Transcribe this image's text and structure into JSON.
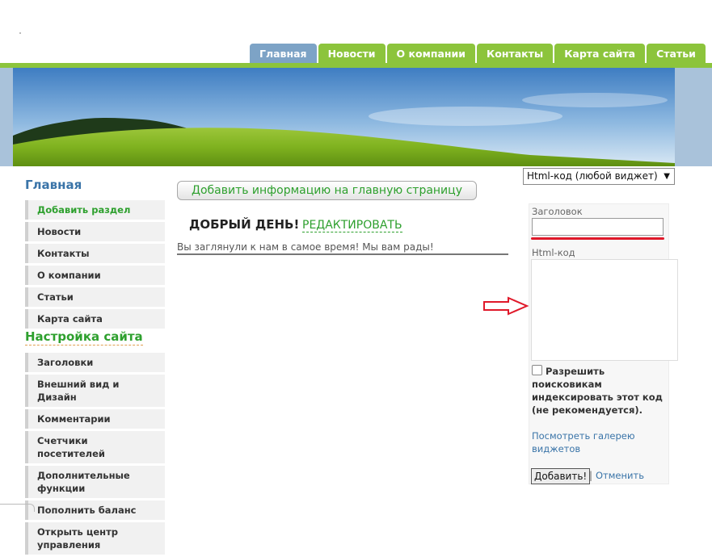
{
  "nav": {
    "tabs": [
      {
        "label": "Главная",
        "active": true
      },
      {
        "label": "Новости",
        "active": false
      },
      {
        "label": "О компании",
        "active": false
      },
      {
        "label": "Контакты",
        "active": false
      },
      {
        "label": "Карта сайта",
        "active": false
      },
      {
        "label": "Статьи",
        "active": false
      }
    ]
  },
  "sidebar": {
    "main_title": "Главная",
    "main_items": [
      "Добавить раздел",
      "Новости",
      "Контакты",
      "О компании",
      "Статьи",
      "Карта сайта"
    ],
    "settings_title": "Настройка сайта",
    "settings_items": [
      "Заголовки",
      "Внешний вид и Дизайн",
      "Комментарии",
      "Счетчики посетителей",
      "Дополнительные функции",
      "Пополнить баланс",
      "Открыть центр управления"
    ]
  },
  "content": {
    "add_info_button": "Добавить информацию на главную страницу",
    "greeting": "ДОБРЫЙ ДЕНЬ!",
    "edit_link": "РЕДАКТИРОВАТЬ",
    "welcome_text": "Вы заглянули к нам в самое время! Мы вам рады!"
  },
  "widget": {
    "select_value": "Html-код (любой виджет)",
    "title_label": "Заголовок",
    "title_value": "",
    "code_label": "Html-код",
    "code_value": "",
    "permit_checked": false,
    "permit_label": "Разрешить поисковикам индексировать этот код (не рекомендуется).",
    "gallery_link": "Посмотреть галерею виджетов",
    "add_button": "Добавить!",
    "separator": "|",
    "cancel_link": "Отменить"
  },
  "colors": {
    "nav_green": "#8cc43c",
    "nav_active": "#7da3c6",
    "accent_green": "#2ea02e",
    "link_blue": "#3a74a8",
    "highlight_red": "#e0192a"
  }
}
